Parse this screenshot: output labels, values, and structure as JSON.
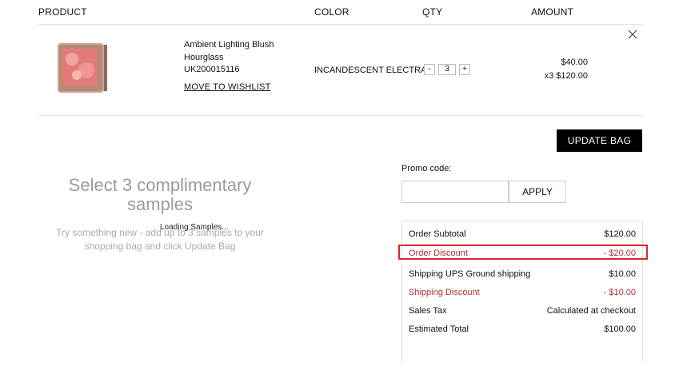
{
  "header": {
    "product": "PRODUCT",
    "color": "COLOR",
    "qty": "QTY",
    "amount": "AMOUNT"
  },
  "item": {
    "name": "Ambient Lighting Blush",
    "brand": "Hourglass",
    "sku": "UK200015116",
    "wishlist": "MOVE TO WISHLIST",
    "color": "INCANDESCENT ELECTRA",
    "qty_minus": "-",
    "qty_value": "3",
    "qty_plus": "+",
    "unit_price": "$40.00",
    "line_total": "x3 $120.00"
  },
  "update_bag": "UPDATE BAG",
  "promo": {
    "label": "Promo code:",
    "value": "",
    "apply": "APPLY"
  },
  "summary": [
    {
      "label": "Order Subtotal",
      "value": "$120.00"
    },
    {
      "label": "Order Discount",
      "value": "- $20.00"
    },
    {
      "label": "Shipping UPS Ground shipping",
      "value": "$10.00"
    },
    {
      "label": "Shipping Discount",
      "value": "- $10.00"
    },
    {
      "label": "Sales Tax",
      "value": "Calculated at checkout"
    },
    {
      "label": "Estimated Total",
      "value": "$100.00"
    }
  ],
  "samples": {
    "title": "Select 3 complimentary samples",
    "subtitle": "Try something new - add up to 3 samples to your shopping bag and click Update Bag",
    "loading": "Loading Samples..."
  },
  "colors": {
    "discount_red": "#b0303b",
    "highlight_red": "#d8262b",
    "button_black": "#000000"
  }
}
